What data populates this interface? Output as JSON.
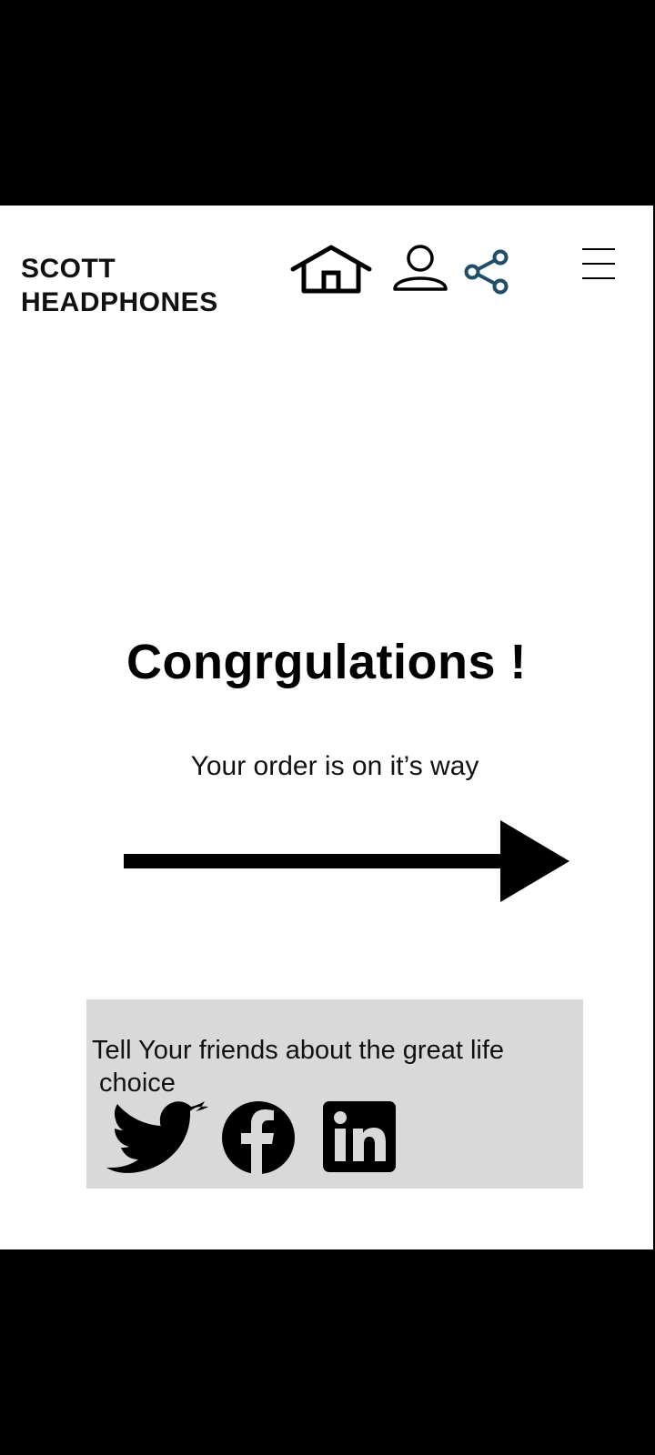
{
  "header": {
    "brand_line1": "SCOTT",
    "brand_line2": "HEADPHONES",
    "icons": [
      "home-icon",
      "user-icon",
      "share-icon",
      "hamburger-menu-icon"
    ]
  },
  "main": {
    "title": "Congrgulations !",
    "subtitle": "Your order is on it’s way",
    "arrow_icon": "right-arrow-icon"
  },
  "share": {
    "text_line1": "Tell Your friends about the great life",
    "text_line2": " choice",
    "networks": [
      "twitter-icon",
      "facebook-icon",
      "linkedin-icon"
    ]
  },
  "colors": {
    "background": "#ffffff",
    "share_box": "#d9d9d9",
    "share_icon_accent": "#1f4e6b",
    "text": "#000000"
  }
}
